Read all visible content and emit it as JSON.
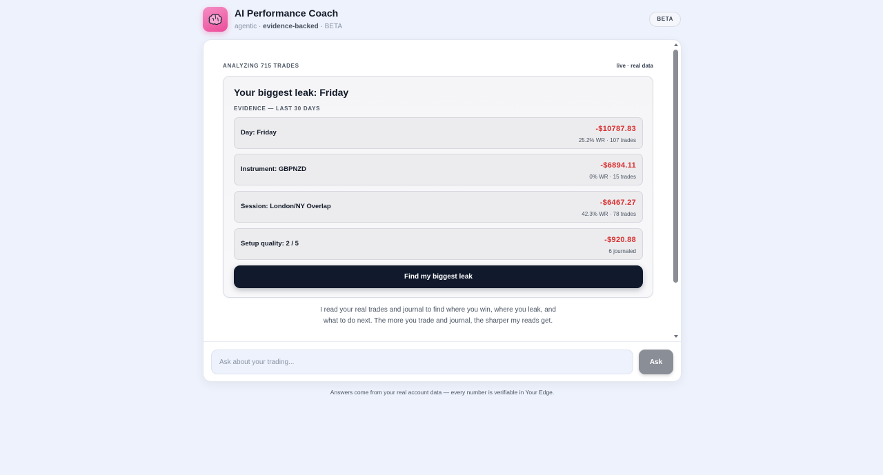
{
  "header": {
    "title": "AI Performance Coach",
    "subtitle_prefix": "agentic ·",
    "subtitle_bold": "evidence-backed",
    "subtitle_suffix": "· BETA",
    "beta_badge": "BETA",
    "icon": "brain-icon",
    "accent": "#ec4c9a"
  },
  "analysis": {
    "analyzing_label": "ANALYZING 715 TRADES",
    "live_label": "live · real data"
  },
  "leak": {
    "title": "Your biggest leak: Friday",
    "evidence_label": "EVIDENCE — LAST 30 DAYS",
    "rows": [
      {
        "label": "Day: Friday",
        "amount": "-$10787.83",
        "detail": "25.2% WR · 107 trades"
      },
      {
        "label": "Instrument: GBPNZD",
        "amount": "-$6894.11",
        "detail": "0% WR · 15 trades"
      },
      {
        "label": "Session: London/NY Overlap",
        "amount": "-$6467.27",
        "detail": "42.3% WR · 78 trades"
      },
      {
        "label": "Setup quality: 2 / 5",
        "amount": "-$920.88",
        "detail": "6 journaled"
      }
    ],
    "button_label": "Find my biggest leak",
    "loss_color": "#d92d2d"
  },
  "intro": {
    "text": "I read your real trades and journal to find where you win, where you leak, and what to do next. The more you trade and journal, the sharper my reads get."
  },
  "composer": {
    "placeholder": "Ask about your trading...",
    "value": "",
    "ask_label": "Ask"
  },
  "footer": {
    "note": "Answers come from your real account data — every number is verifiable in Your Edge."
  }
}
